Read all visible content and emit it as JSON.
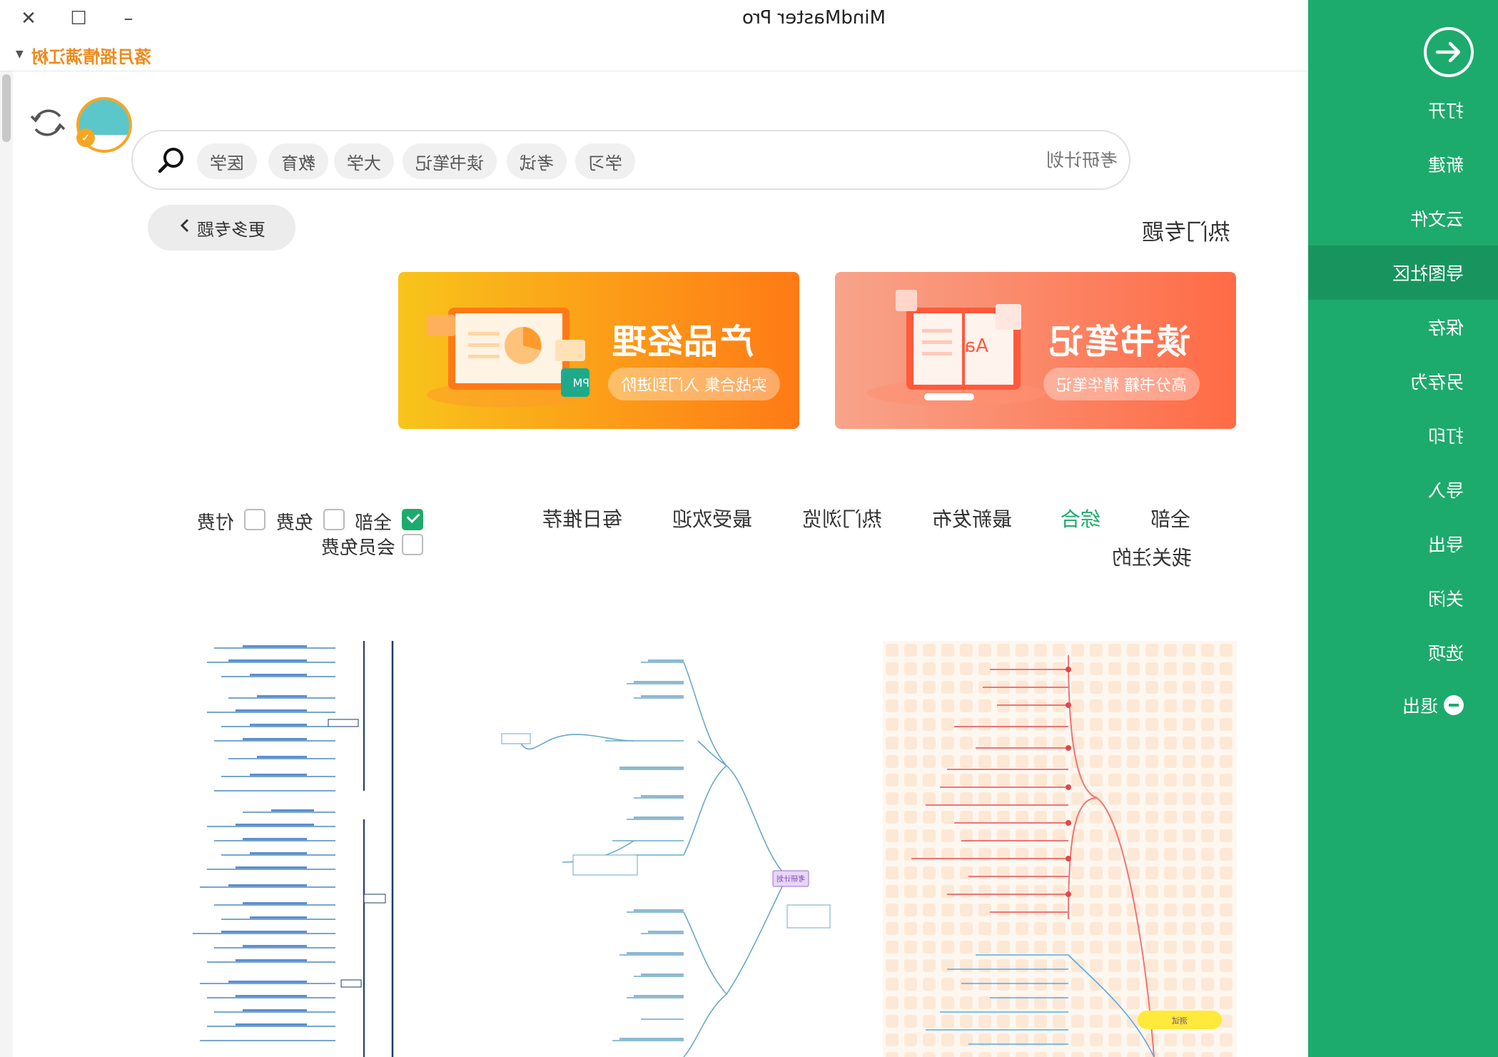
{
  "window": {
    "title": "MindMaster Pro",
    "close_glyph": "✕",
    "maximize_glyph": "☐",
    "minimize_glyph": "–"
  },
  "user": {
    "name": "落月摇情满江树"
  },
  "sidebar": {
    "items": [
      {
        "label": "打开",
        "active": false
      },
      {
        "label": "新建",
        "active": false
      },
      {
        "label": "云文件",
        "active": false
      },
      {
        "label": "导图社区",
        "active": true
      },
      {
        "label": "保存",
        "active": false
      },
      {
        "label": "另存为",
        "active": false
      },
      {
        "label": "打印",
        "active": false
      },
      {
        "label": "导入",
        "active": false
      },
      {
        "label": "导出",
        "active": false
      },
      {
        "label": "关闭",
        "active": false
      },
      {
        "label": "选项",
        "active": false
      },
      {
        "label": "退出",
        "active": false
      }
    ],
    "accent": "#1daa6d",
    "icons": [
      "back-arrow-icon",
      "exit-icon"
    ]
  },
  "search": {
    "placeholder": "考研计划",
    "tags": [
      "学习",
      "考试",
      "读书笔记",
      "大学",
      "教育",
      "医学"
    ]
  },
  "hot_topics": {
    "title": "热门专题",
    "more_label": "更多专题",
    "banners": [
      {
        "title": "读书笔记",
        "subtitle": "高分书籍 精华笔记",
        "color": "#ff6b45"
      },
      {
        "title": "产品经理",
        "subtitle": "实战合集 入门到进阶",
        "color": "#ff8a16"
      }
    ]
  },
  "filters": {
    "tabs": [
      {
        "label": "全部",
        "active": false
      },
      {
        "label": "综合",
        "active": true
      },
      {
        "label": "最新发布",
        "active": false
      },
      {
        "label": "热门浏览",
        "active": false
      },
      {
        "label": "最受欢迎",
        "active": false
      },
      {
        "label": "每日推荐",
        "active": false
      },
      {
        "label": "我关注的",
        "active": false
      }
    ],
    "price": [
      {
        "label": "全部",
        "checked": true
      },
      {
        "label": "免费",
        "checked": false
      },
      {
        "label": "付费",
        "checked": false
      },
      {
        "label": "会员免费",
        "checked": false
      }
    ]
  },
  "cards": [
    {
      "node_label": "考研计划"
    },
    {
      "node_label": "考研计划"
    },
    {
      "node_label": "测试"
    }
  ]
}
